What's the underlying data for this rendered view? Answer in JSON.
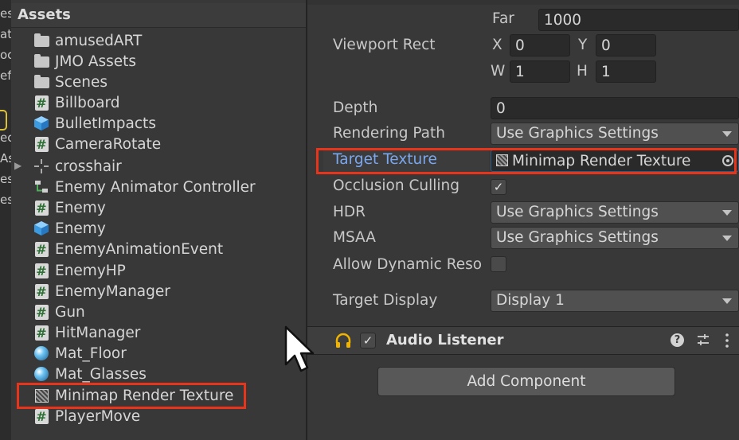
{
  "left_edge": {
    "fragments": [
      "es",
      "at",
      "oc",
      "ef",
      "ec",
      "As",
      "es",
      "es"
    ]
  },
  "assets_panel": {
    "title": "Assets",
    "items": [
      {
        "label": "amusedART",
        "icon": "folder-icon"
      },
      {
        "label": "JMO Assets",
        "icon": "folder-icon"
      },
      {
        "label": "Scenes",
        "icon": "folder-icon"
      },
      {
        "label": "Billboard",
        "icon": "script-icon"
      },
      {
        "label": "BulletImpacts",
        "icon": "prefab-icon"
      },
      {
        "label": "CameraRotate",
        "icon": "script-icon"
      },
      {
        "label": "crosshair",
        "icon": "crosshair-icon"
      },
      {
        "label": "Enemy Animator Controller",
        "icon": "animator-controller-icon"
      },
      {
        "label": "Enemy",
        "icon": "script-icon"
      },
      {
        "label": "Enemy",
        "icon": "prefab-icon"
      },
      {
        "label": "EnemyAnimationEvent",
        "icon": "script-icon"
      },
      {
        "label": "EnemyHP",
        "icon": "script-icon"
      },
      {
        "label": "EnemyManager",
        "icon": "script-icon"
      },
      {
        "label": "Gun",
        "icon": "script-icon"
      },
      {
        "label": "HitManager",
        "icon": "script-icon"
      },
      {
        "label": "Mat_Floor",
        "icon": "material-icon"
      },
      {
        "label": "Mat_Glasses",
        "icon": "material-icon"
      },
      {
        "label": "Minimap Render Texture",
        "icon": "render-texture-icon",
        "highlighted": true
      },
      {
        "label": "PlayerMove",
        "icon": "script-icon"
      }
    ]
  },
  "inspector": {
    "far_label": "Far",
    "far_value": "1000",
    "viewport_rect": {
      "label": "Viewport Rect",
      "x_label": "X",
      "x": "0",
      "y_label": "Y",
      "y": "0",
      "w_label": "W",
      "w": "1",
      "h_label": "H",
      "h": "1"
    },
    "depth": {
      "label": "Depth",
      "value": "0"
    },
    "rendering_path": {
      "label": "Rendering Path",
      "value": "Use Graphics Settings"
    },
    "target_texture": {
      "label": "Target Texture",
      "value": "Minimap Render Texture"
    },
    "occlusion_culling": {
      "label": "Occlusion Culling",
      "checked": true,
      "check": "✓"
    },
    "hdr": {
      "label": "HDR",
      "value": "Use Graphics Settings"
    },
    "msaa": {
      "label": "MSAA",
      "value": "Use Graphics Settings"
    },
    "allow_dynamic": {
      "label": "Allow Dynamic Reso",
      "checked": false
    },
    "target_display": {
      "label": "Target Display",
      "value": "Display 1"
    },
    "audio_listener": {
      "label": "Audio Listener",
      "enabled": true,
      "check": "✓",
      "help": "?"
    },
    "add_component": "Add Component"
  },
  "accent": {
    "highlight": "#e8341a",
    "link_label": "#7ba7ee",
    "selection": "#2c5d87"
  }
}
